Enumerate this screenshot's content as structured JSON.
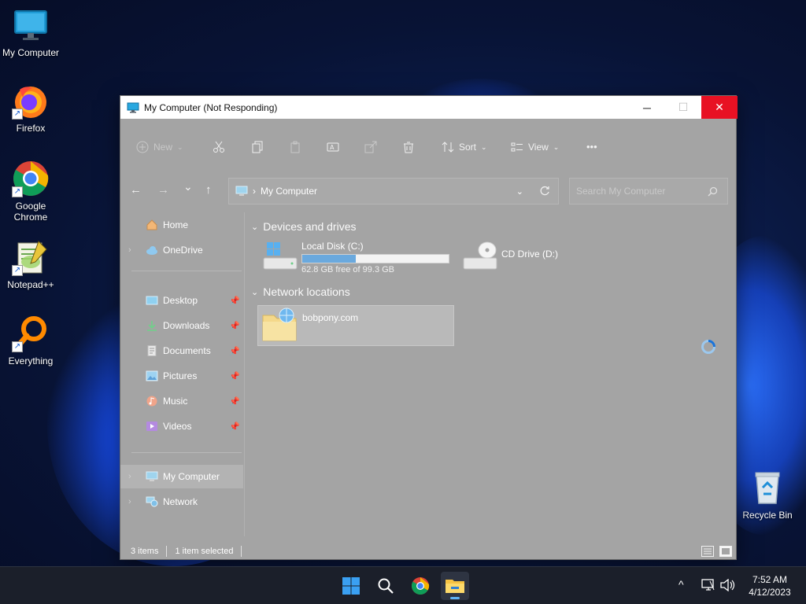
{
  "desktop": {
    "icons": [
      {
        "label": "My Computer",
        "icon": "monitor-icon"
      },
      {
        "label": "Firefox",
        "icon": "firefox-icon"
      },
      {
        "label": "Google Chrome",
        "icon": "chrome-icon"
      },
      {
        "label": "Notepad++",
        "icon": "notepadpp-icon"
      },
      {
        "label": "Everything",
        "icon": "search-magnifier-icon"
      },
      {
        "label": "Recycle Bin",
        "icon": "recycle-bin-icon"
      }
    ]
  },
  "window": {
    "title": "My Computer (Not Responding)",
    "controls": {
      "minimize": "─",
      "maximize": "☐",
      "close": "✕"
    },
    "toolbar": {
      "new_label": "New",
      "sort_label": "Sort",
      "view_label": "View",
      "more_label": "•••"
    },
    "nav": {
      "back": "←",
      "forward": "→",
      "recent": "⌄",
      "up": "↑",
      "address_separator": "›",
      "address": "My Computer",
      "search_placeholder": "Search My Computer"
    },
    "sidebar": {
      "home": "Home",
      "onedrive": "OneDrive",
      "desktop": "Desktop",
      "downloads": "Downloads",
      "documents": "Documents",
      "pictures": "Pictures",
      "music": "Music",
      "videos": "Videos",
      "my_computer": "My Computer",
      "network": "Network"
    },
    "content": {
      "devices_heading": "Devices and drives",
      "local_disk": {
        "name": "Local Disk (C:)",
        "free_text": "62.8 GB free of 99.3 GB",
        "used_fraction": 0.368
      },
      "cd_drive": {
        "name": "CD Drive (D:)"
      },
      "network_heading": "Network locations",
      "network_item": "bobpony.com"
    },
    "status": {
      "items": "3 items",
      "selected": "1 item selected"
    }
  },
  "taskbar": {
    "time": "7:52 AM",
    "date": "4/12/2023",
    "tray_chevron": "^"
  },
  "colors": {
    "close_button": "#e81123",
    "accent": "#5fb2f2",
    "window_dimmed": "#a4a4a4"
  }
}
